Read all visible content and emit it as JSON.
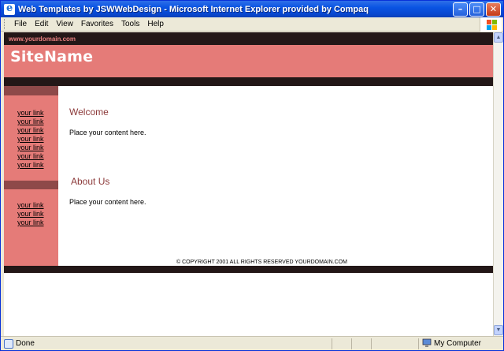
{
  "window": {
    "title": "Web Templates by JSWWebDesign - Microsoft Internet Explorer provided by Compaq",
    "minimize_glyph": "–",
    "maximize_glyph": "□",
    "close_glyph": "✕"
  },
  "menu": {
    "items": [
      "File",
      "Edit",
      "View",
      "Favorites",
      "Tools",
      "Help"
    ]
  },
  "page": {
    "domain": "www.yourdomain.com",
    "site_name": "SiteName",
    "sidebar_links_top": [
      "your link",
      "your link",
      "your link",
      "your link",
      "your link",
      "your link",
      "your link"
    ],
    "sidebar_links_bottom": [
      "your link",
      "your link",
      "your link"
    ],
    "sections": [
      {
        "heading": "Welcome",
        "body": "Place your content here."
      },
      {
        "heading": "About Us",
        "body": "Place your content here."
      }
    ],
    "copyright": "© COPYRIGHT 2001 ALL RIGHTS RESERVED YOURDOMAIN.COM"
  },
  "status": {
    "text": "Done",
    "zone": "My Computer"
  },
  "icons": {
    "app": "ie-icon",
    "windows": "windows-flag-icon",
    "status": "page-done-icon",
    "zone": "computer-icon"
  },
  "colors": {
    "header_pink": "#e57b78",
    "dark_bar": "#231717",
    "sidebar_accent": "#8e4949",
    "heading": "#8c3a3a",
    "titlebar_blue": "#0a54e3"
  }
}
